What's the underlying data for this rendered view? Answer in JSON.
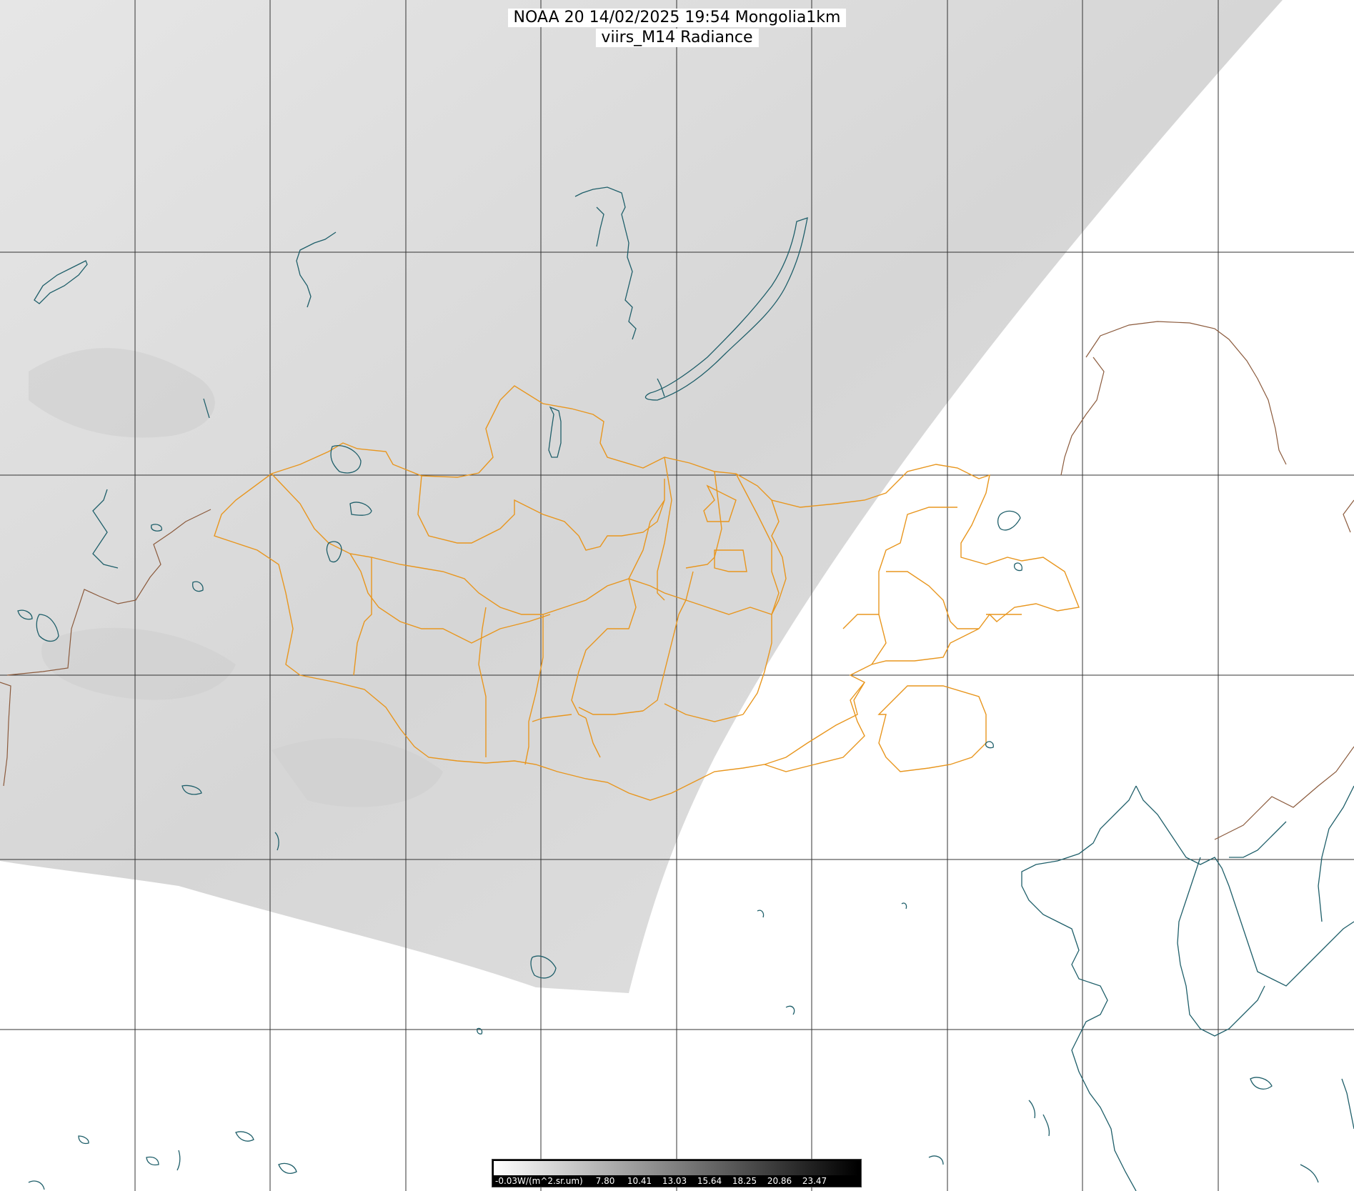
{
  "title": {
    "line1": "NOAA 20 14/02/2025 19:54 Mongolia1km",
    "line2": "viirs_M14 Radiance"
  },
  "colorbar": {
    "unit_label": "-0.03W/(m^2.sr.um)",
    "ticks": [
      "7.80",
      "10.41",
      "13.03",
      "15.64",
      "18.25",
      "20.86",
      "23.47"
    ],
    "colors": {
      "low": "#ffffff",
      "high": "#000000"
    }
  },
  "colors": {
    "grid": "#333333",
    "coast": "#1f5f6a",
    "country_border": "#8b5a3c",
    "admin_border": "#e8961e",
    "imagery": "#dcdcdc",
    "background": "#ffffff"
  }
}
